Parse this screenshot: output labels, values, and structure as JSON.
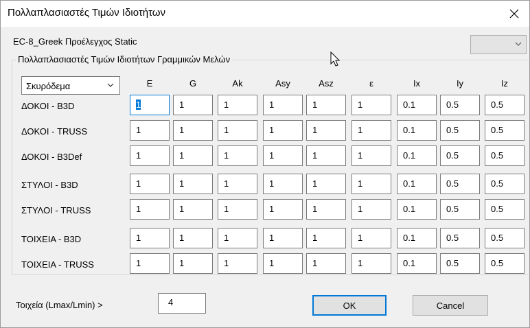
{
  "window": {
    "title": "Πολλαπλασιαστές Τιμών Ιδιοτήτων"
  },
  "header": {
    "subtitle": "EC-8_Greek Προέλεγχος Static",
    "combo_value": ""
  },
  "group": {
    "label": "Πολλαπλασιαστές Τιμών Ιδιοτήτων Γραμμικών Μελών",
    "material": "Σκυρόδεμα",
    "columns": [
      "E",
      "G",
      "Ak",
      "Asy",
      "Asz",
      "ε",
      "Ix",
      "Iy",
      "Iz"
    ],
    "rows": [
      {
        "label": "ΔΟΚΟΙ - B3D",
        "values": [
          "1",
          "1",
          "1",
          "1",
          "1",
          "1",
          "0.1",
          "0.5",
          "0.5"
        ]
      },
      {
        "label": "ΔΟΚΟΙ - TRUSS",
        "values": [
          "1",
          "1",
          "1",
          "1",
          "1",
          "1",
          "0.1",
          "0.5",
          "0.5"
        ]
      },
      {
        "label": "ΔΟΚΟΙ - B3Def",
        "values": [
          "1",
          "1",
          "1",
          "1",
          "1",
          "1",
          "0.1",
          "0.5",
          "0.5"
        ]
      },
      {
        "label": "ΣΤΥΛΟΙ - B3D",
        "values": [
          "1",
          "1",
          "1",
          "1",
          "1",
          "1",
          "0.1",
          "0.5",
          "0.5"
        ]
      },
      {
        "label": "ΣΤΥΛΟΙ - TRUSS",
        "values": [
          "1",
          "1",
          "1",
          "1",
          "1",
          "1",
          "0.1",
          "0.5",
          "0.5"
        ]
      },
      {
        "label": "ΤΟΙΧΕΙΑ - B3D",
        "values": [
          "1",
          "1",
          "1",
          "1",
          "1",
          "1",
          "0.1",
          "0.5",
          "0.5"
        ]
      },
      {
        "label": "ΤΟΙΧΕΙΑ - TRUSS",
        "values": [
          "1",
          "1",
          "1",
          "1",
          "1",
          "1",
          "0.1",
          "0.5",
          "0.5"
        ]
      }
    ]
  },
  "footer": {
    "ratio_label": "Τοιχεία (Lmax/Lmin) >",
    "ratio_value": "4",
    "ok_label": "OK",
    "cancel_label": "Cancel"
  },
  "colors": {
    "accent": "#0078d7",
    "dialog_bg": "#f0f0f0"
  }
}
